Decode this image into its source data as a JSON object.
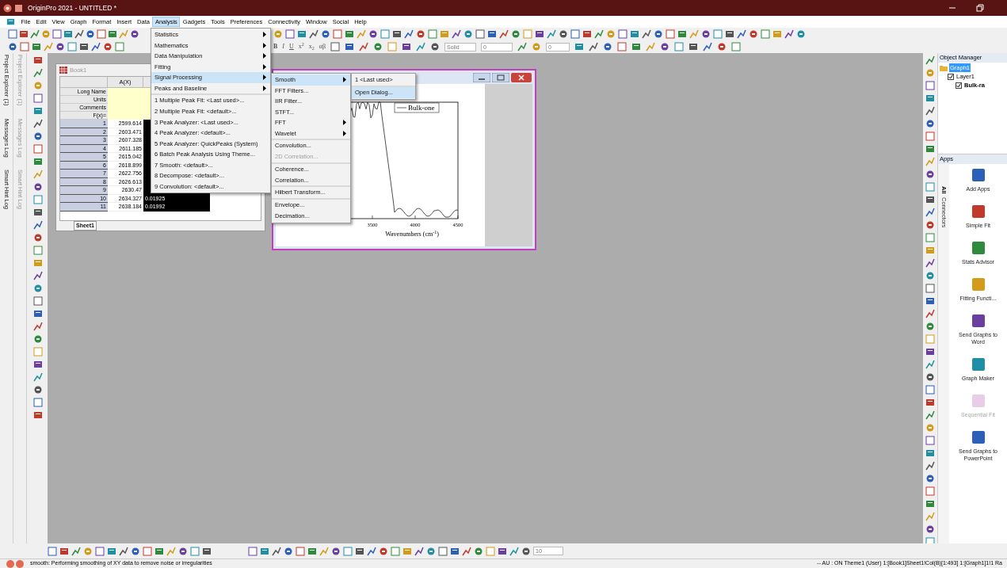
{
  "window": {
    "title": "OriginPro 2021 - UNTITLED *"
  },
  "menu_bar": [
    {
      "label": "File",
      "selected": false
    },
    {
      "label": "Edit",
      "selected": false
    },
    {
      "label": "View",
      "selected": false
    },
    {
      "label": "Graph",
      "selected": false
    },
    {
      "label": "Format",
      "selected": false
    },
    {
      "label": "Insert",
      "selected": false
    },
    {
      "label": "Data",
      "selected": false
    },
    {
      "label": "Analysis",
      "selected": true
    },
    {
      "label": "Gadgets",
      "selected": false
    },
    {
      "label": "Tools",
      "selected": false
    },
    {
      "label": "Preferences",
      "selected": false
    },
    {
      "label": "Connectivity",
      "selected": false
    },
    {
      "label": "Window",
      "selected": false
    },
    {
      "label": "Social",
      "selected": false
    },
    {
      "label": "Help",
      "selected": false
    }
  ],
  "format_toolbar": {
    "buttons": [
      "B",
      "I",
      "U",
      "x$^{2}$",
      "x$_{2}$",
      "αβ"
    ],
    "line_style": "Solid",
    "size_1": "0",
    "size_2": "0"
  },
  "left_dock_tabs": [
    {
      "labels": [
        "Project Explorer (1)",
        "Messages Log",
        "Smart Hint Log"
      ],
      "selected": true
    },
    {
      "labels": [
        "Project Explorer (1)",
        "Messages Log",
        "Smart Hint Log"
      ],
      "selected": false
    }
  ],
  "analysis_menu": [
    {
      "label": "Statistics",
      "submenu": true,
      "selected": false,
      "separator_before": false
    },
    {
      "label": "Mathematics",
      "submenu": true,
      "selected": false,
      "separator_before": false
    },
    {
      "label": "Data Manipulation",
      "submenu": true,
      "selected": false,
      "separator_before": false
    },
    {
      "label": "Fitting",
      "submenu": true,
      "selected": false,
      "separator_before": false
    },
    {
      "label": "Signal Processing",
      "submenu": true,
      "selected": true,
      "separator_before": false
    },
    {
      "label": "Peaks and Baseline",
      "submenu": true,
      "selected": false,
      "separator_before": false
    },
    {
      "label": "1 Multiple Peak Fit: <Last used>...",
      "submenu": false,
      "selected": false,
      "separator_before": true
    },
    {
      "label": "2 Multiple Peak Fit: <default>...",
      "submenu": false,
      "selected": false,
      "separator_before": false
    },
    {
      "label": "3 Peak Analyzer: <Last used>...",
      "submenu": false,
      "selected": false,
      "separator_before": false
    },
    {
      "label": "4 Peak Analyzer: <default>...",
      "submenu": false,
      "selected": false,
      "separator_before": false
    },
    {
      "label": "5 Peak Analyzer: QuickPeaks (System)",
      "submenu": false,
      "selected": false,
      "separator_before": false
    },
    {
      "label": "6 Batch Peak Analysis Using Theme...",
      "submenu": false,
      "selected": false,
      "separator_before": false
    },
    {
      "label": "7 Smooth: <default>...",
      "submenu": false,
      "selected": false,
      "separator_before": false
    },
    {
      "label": "8 Decompose: <default>...",
      "submenu": false,
      "selected": false,
      "separator_before": false
    },
    {
      "label": "9 Convolution: <default>...",
      "submenu": false,
      "selected": false,
      "separator_before": false
    }
  ],
  "signal_processing_menu": [
    {
      "label": "Smooth",
      "submenu": true,
      "selected": true,
      "disabled": false,
      "separator_before": false
    },
    {
      "label": "FFT Filters...",
      "submenu": false,
      "selected": false,
      "disabled": false,
      "separator_before": false
    },
    {
      "label": "IIR Filter...",
      "submenu": false,
      "selected": false,
      "disabled": false,
      "separator_before": false
    },
    {
      "label": "STFT...",
      "submenu": false,
      "selected": false,
      "disabled": false,
      "separator_before": false
    },
    {
      "label": "FFT",
      "submenu": true,
      "selected": false,
      "disabled": false,
      "separator_before": false
    },
    {
      "label": "Wavelet",
      "submenu": true,
      "selected": false,
      "disabled": false,
      "separator_before": false
    },
    {
      "label": "Convolution...",
      "submenu": false,
      "selected": false,
      "disabled": false,
      "separator_before": true
    },
    {
      "label": "2D Correlation...",
      "submenu": false,
      "selected": false,
      "disabled": true,
      "separator_before": false
    },
    {
      "label": "Coherence...",
      "submenu": false,
      "selected": false,
      "disabled": false,
      "separator_before": true
    },
    {
      "label": "Correlation...",
      "submenu": false,
      "selected": false,
      "disabled": false,
      "separator_before": false
    },
    {
      "label": "Hilbert Transform...",
      "submenu": false,
      "selected": false,
      "disabled": false,
      "separator_before": true
    },
    {
      "label": "Envelope...",
      "submenu": false,
      "selected": false,
      "disabled": false,
      "separator_before": true
    },
    {
      "label": "Decimation...",
      "submenu": false,
      "selected": false,
      "disabled": false,
      "separator_before": false
    }
  ],
  "smooth_menu": [
    {
      "label": "1 <Last used>",
      "selected": false,
      "separator_before": false
    },
    {
      "label": "Open Dialog...",
      "selected": true,
      "separator_before": true
    }
  ],
  "worksheet": {
    "title": "Book1",
    "columns": [
      "A(X)"
    ],
    "label_rows": [
      "Long Name",
      "Units",
      "Comments",
      "F(x)="
    ],
    "rows": [
      {
        "index": "1",
        "a": "2599.614"
      },
      {
        "index": "2",
        "a": "2603.471"
      },
      {
        "index": "3",
        "a": "2607.328"
      },
      {
        "index": "4",
        "a": "2611.185"
      },
      {
        "index": "5",
        "a": "2615.042"
      },
      {
        "index": "6",
        "a": "2618.899"
      },
      {
        "index": "7",
        "a": "2622.756"
      },
      {
        "index": "8",
        "a": "2626.613"
      },
      {
        "index": "9",
        "a": "2630.47"
      },
      {
        "index": "10",
        "a": "2634.327",
        "b": "0.01925"
      },
      {
        "index": "11",
        "a": "2638.184",
        "b": "0.01992"
      }
    ],
    "sheet_tab": "Sheet1"
  },
  "graph": {
    "legend": "Bulk-one",
    "x_tick_labels": [
      "3500",
      "4000",
      "4500"
    ],
    "x_axis_title": "Wavenumbers (cm$^{-1}$)"
  },
  "object_manager": {
    "title": "Object Manager",
    "tree": [
      {
        "label": "Graph1",
        "selected": true,
        "children": [
          {
            "label": "Layer1",
            "checked": true,
            "children": [
              {
                "label": "Bulk-ra",
                "checked": true
              }
            ]
          }
        ]
      }
    ]
  },
  "apps": {
    "title": "Apps",
    "tabs": [
      {
        "label": "All",
        "selected": true
      },
      {
        "label": "Connectors",
        "selected": false
      }
    ],
    "items": [
      {
        "label": "Add Apps",
        "disabled": false
      },
      {
        "label": "Simple Fit",
        "disabled": false
      },
      {
        "label": "Stats Advisor",
        "disabled": false
      },
      {
        "label": "Fitting Functi...",
        "disabled": false
      },
      {
        "label": "Send Graphs to Word",
        "disabled": false
      },
      {
        "label": "Graph Maker",
        "disabled": false
      },
      {
        "label": "Sequential Fit",
        "disabled": true
      },
      {
        "label": "Send Graphs to PowerPoint",
        "disabled": false
      }
    ]
  },
  "bottom_toolbar": {
    "size": "10"
  },
  "status_bar": {
    "message": "smooth: Performing smoothing of XY data to remove noise or irregularities",
    "info": "-- AU : ON Theme1 (User) 1:[Book1]Sheet1!Col(B)[1:493] 1:[Graph1]1!1 Ra"
  }
}
